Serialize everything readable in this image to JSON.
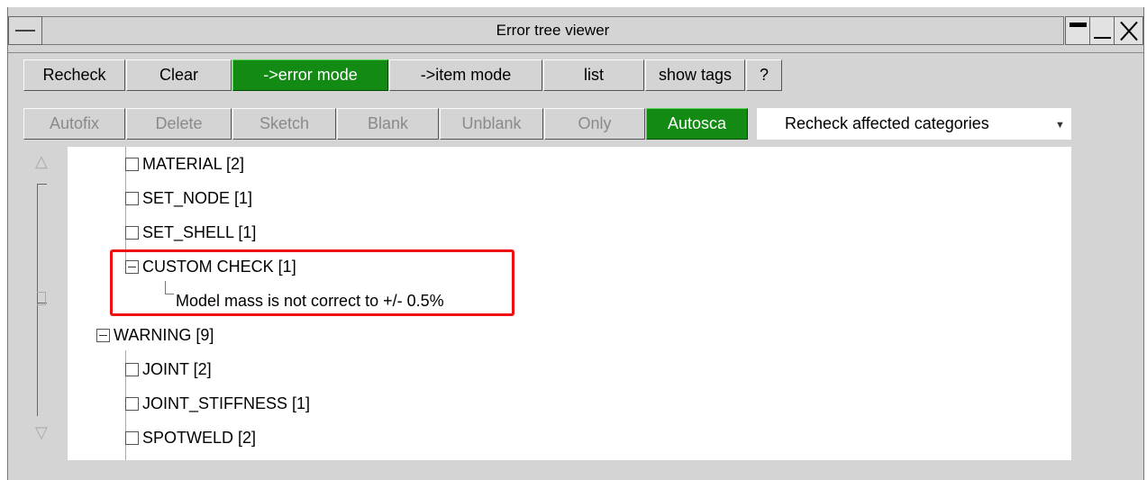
{
  "window": {
    "title": "Error tree viewer"
  },
  "toolbar1": {
    "recheck": "Recheck",
    "clear": "Clear",
    "error_mode": "->error mode",
    "item_mode": "->item mode",
    "list": "list",
    "show_tags": "show tags",
    "help": "?"
  },
  "toolbar2": {
    "autofix": "Autofix",
    "delete": "Delete",
    "sketch": "Sketch",
    "blank": "Blank",
    "unblank": "Unblank",
    "only": "Only",
    "autoscale": "Autosca",
    "recheck_option": "Recheck affected categories"
  },
  "tree": {
    "items": [
      {
        "label": "MATERIAL [2]"
      },
      {
        "label": "SET_NODE [1]"
      },
      {
        "label": "SET_SHELL [1]"
      },
      {
        "label": "CUSTOM CHECK [1]"
      },
      {
        "label": "Model mass is not correct to +/- 0.5%"
      },
      {
        "label": "WARNING [9]"
      },
      {
        "label": "JOINT [2]"
      },
      {
        "label": "JOINT_STIFFNESS [1]"
      },
      {
        "label": "SPOTWELD [2]"
      }
    ]
  },
  "colors": {
    "active_button": "#138a13",
    "highlight": "#ee1010",
    "panel": "#d4d4d4"
  }
}
